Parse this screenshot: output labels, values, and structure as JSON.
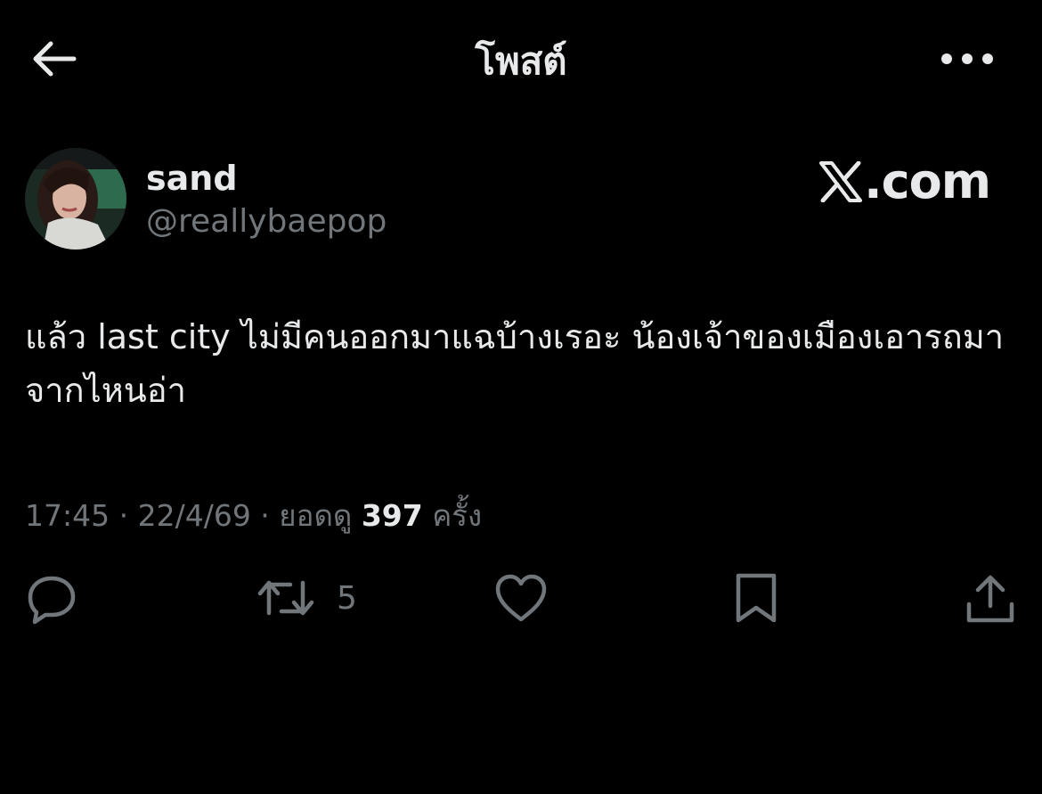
{
  "header": {
    "title": "โพสต์",
    "back_icon": "arrow-left-icon",
    "more_icon": "more-horizontal-icon"
  },
  "author": {
    "display_name": "sand",
    "handle": "@reallybaepop",
    "avatar": "avatar"
  },
  "brand": {
    "label": ".com"
  },
  "tweet": {
    "text": "แล้ว last city ไม่มีคนออกมาแฉบ้างเรอะ น้องเจ้าของเมืองเอารถมาจากไหนอ่า"
  },
  "meta": {
    "time": "17:45",
    "sep1": " · ",
    "date": "22/4/69",
    "sep2": " · ",
    "views_label": "ยอดดู",
    "views_count": "397",
    "views_unit": "ครั้ง"
  },
  "actions": {
    "reply": {
      "icon": "reply-icon"
    },
    "repost": {
      "icon": "repost-icon",
      "count": "5"
    },
    "like": {
      "icon": "heart-icon"
    },
    "bookmark": {
      "icon": "bookmark-icon"
    },
    "share": {
      "icon": "share-icon"
    }
  },
  "colors": {
    "background": "#000000",
    "primary_text": "#e7e9ea",
    "secondary_text": "#71767b"
  }
}
